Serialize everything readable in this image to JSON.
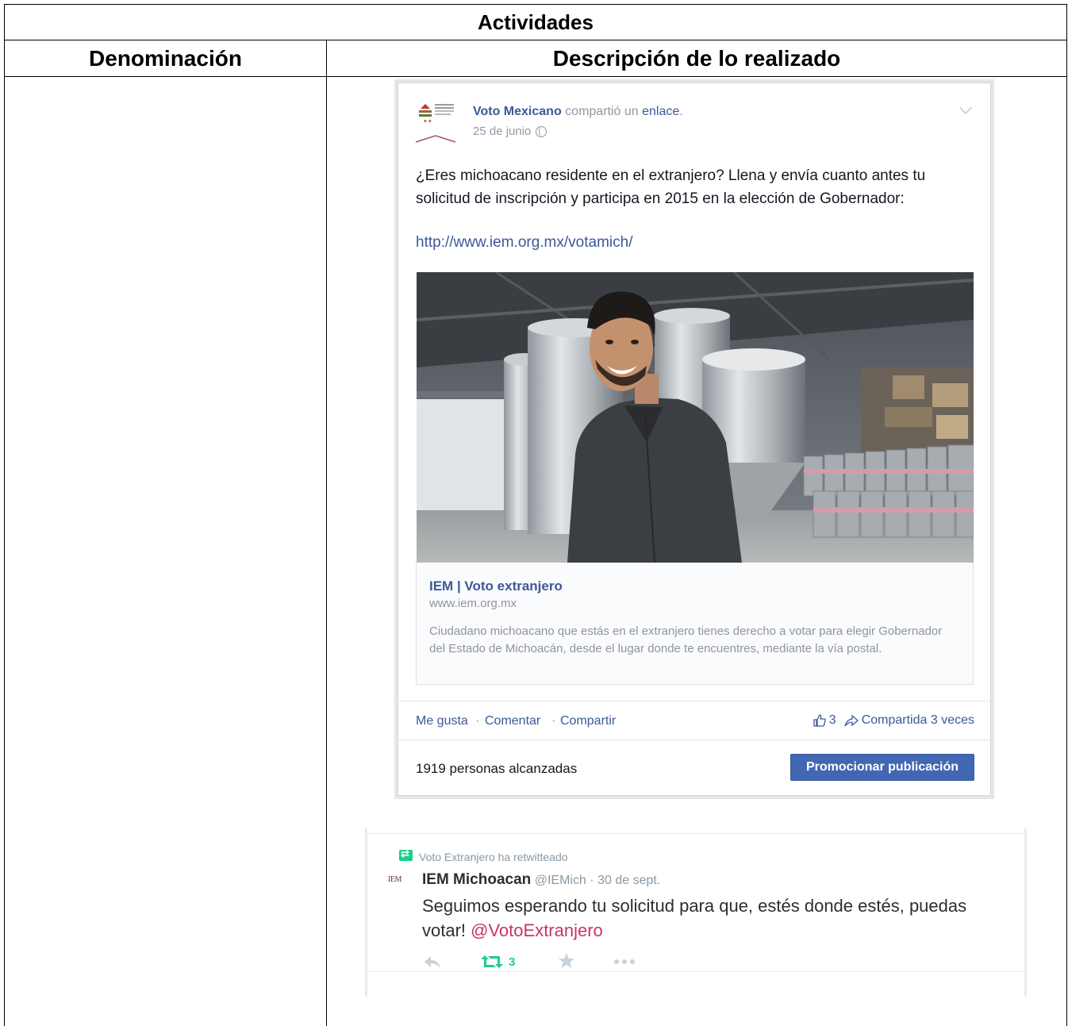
{
  "table": {
    "title": "Actividades",
    "col_left": "Denominación",
    "col_right": "Descripción de lo realizado"
  },
  "fb_post": {
    "author": "Voto Mexicano",
    "action": " compartió un ",
    "action_link": "enlace",
    "action_end": ".",
    "date": "25 de junio",
    "text": "¿Eres michoacano residente en el extranjero? Llena y envía cuanto antes tu solicitud de inscripción y participa en 2015 en la elección de Gobernador:",
    "url": "http://www.iem.org.mx/votamich/",
    "link_title": "IEM | Voto extranjero",
    "link_domain": "www.iem.org.mx",
    "link_description": "Ciudadano michoacano que estás en el extranjero tienes derecho a votar para elegir Gobernador del Estado de Michoacán, desde el lugar donde te encuentres, mediante la vía postal.",
    "like_label": "Me gusta",
    "comment_label": "Comentar",
    "share_label": "Compartir",
    "separator": "·",
    "likes_count": "3",
    "shares_label": "Compartida 3 veces",
    "reach": "1919 personas alcanzadas",
    "promote_label": "Promocionar publicación",
    "colors": {
      "link": "#3b5998",
      "button": "#4267b2"
    }
  },
  "tweet": {
    "retweeted_by": "Voto Extranjero ha retwitteado",
    "avatar_text": "IEM",
    "name": "IEM Michoacan",
    "handle": "@IEMich",
    "separator": "·",
    "date": "30 de sept.",
    "text": "Seguimos esperando tu solicitud para que, estés donde estés, puedas votar! ",
    "mention": "@VotoExtranjero",
    "retweet_count": "3",
    "colors": {
      "mention": "#c5346e",
      "retweet": "#19cf86"
    }
  }
}
